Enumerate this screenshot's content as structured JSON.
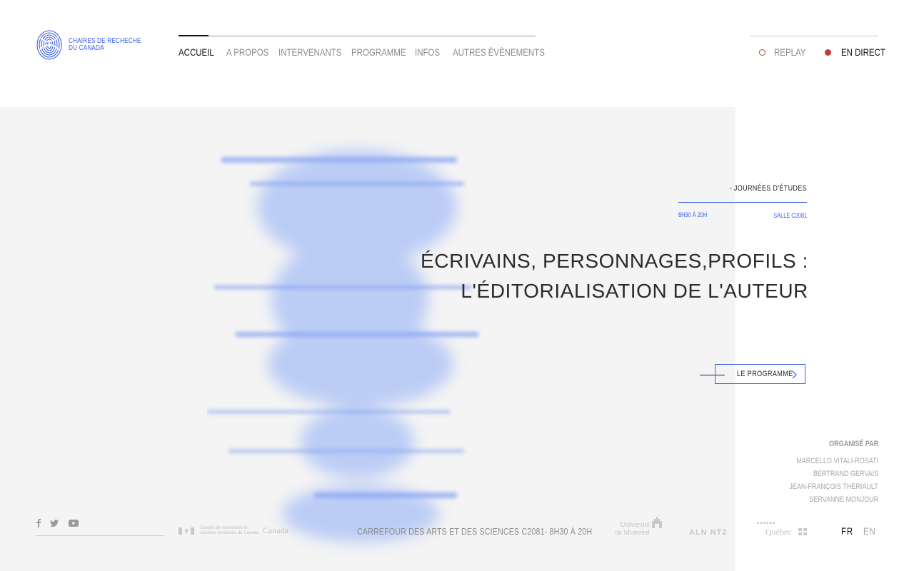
{
  "logo": {
    "text": "CHAIRES DE RECHECHE DU CANADA",
    "line1": "CHAIRES DE RECHECHE",
    "line2": "DU CANADA",
    "icon": "fingerprint-icon",
    "color": "#3a5ee3"
  },
  "nav": {
    "items": [
      {
        "label": "ACCUEIL",
        "active": true
      },
      {
        "label": "A PROPOS",
        "active": false
      },
      {
        "label": "INTERVENANTS",
        "active": false
      },
      {
        "label": "PROGRAMME",
        "active": false
      },
      {
        "label": "INFOS",
        "active": false
      },
      {
        "label": "AUTRES ÉVÈNEMENTS",
        "active": false
      }
    ]
  },
  "live": {
    "replay": {
      "label": "REPLAY",
      "icon": "ring-icon"
    },
    "direct": {
      "label": "EN DIRECT",
      "icon": "red-dot-icon",
      "color": "#c23b37"
    }
  },
  "hero": {
    "event_type": "- JOURNÉES D'ÉTUDES",
    "hours": "8H30 À 20H",
    "room": "SALLE C2081",
    "title_line1": "ÉCRIVAINS, PERSONNAGES,PROFILS :",
    "title_line2": "L'ÉDITORIALISATION DE L'AUTEUR",
    "cta_label": "LE PROGRAMME",
    "accent": "#3a5ee3"
  },
  "organizers": {
    "title": "ORGANISÉ PAR",
    "names": [
      "MARCELLO VITALI-ROSATI",
      "BERTRAND GERVAIS",
      "JEAN-FRANÇOIS THERIAULT",
      "SERVANNE MONJOUR"
    ]
  },
  "footer": {
    "social": [
      "facebook-icon",
      "twitter-icon",
      "youtube-icon"
    ],
    "sponsor_crsh": "Conseil de recherches en sciences humaines du Canada",
    "sponsor_canada": "Canada",
    "venue_text": "CARREFOUR DES ARTS ET DES SCIENCES C2081- 8H30 À 20H",
    "logo_udem_1": "Université",
    "logo_udem_2": "de Montréal",
    "logo_alnt": "ALN NT2",
    "logo_frq": "Québec",
    "languages": {
      "fr": "FR",
      "en": "EN",
      "active": "FR"
    }
  }
}
